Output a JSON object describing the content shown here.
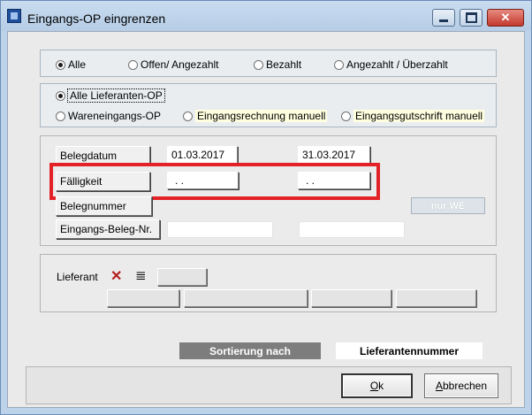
{
  "window": {
    "title": "Eingangs-OP eingrenzen",
    "controls": {
      "close_glyph": "✕"
    }
  },
  "status_filter": {
    "options": [
      {
        "label": "Alle",
        "selected": true
      },
      {
        "label": "Offen/ Angezahlt",
        "selected": false
      },
      {
        "label": "Bezahlt",
        "selected": false
      },
      {
        "label": "Angezahlt / Überzahlt",
        "selected": false
      }
    ]
  },
  "type_filter": {
    "options": [
      {
        "label": "Alle Lieferanten-OP",
        "selected": true
      },
      {
        "label": "Wareneingangs-OP",
        "selected": false
      },
      {
        "label": "Eingangsrechnung manuell",
        "selected": false
      },
      {
        "label": "Eingangsgutschrift manuell",
        "selected": false
      }
    ]
  },
  "ranges": {
    "belegdatum": {
      "label": "Belegdatum",
      "from": "01.03.2017",
      "to": "31.03.2017"
    },
    "faelligkeit": {
      "label": "Fälligkeit",
      "from": ". .",
      "to": ". ."
    },
    "belegnummer": {
      "label": "Belegnummer",
      "nur_we_label": "nur WE"
    },
    "eingangs_beleg_nr": {
      "label": "Eingangs-Beleg-Nr.",
      "from": "",
      "to": ""
    }
  },
  "lieferant": {
    "label": "Lieferant",
    "clear_glyph": "✕",
    "list_glyph": "≣"
  },
  "sort": {
    "label": "Sortierung nach",
    "value": "Lieferantennummer"
  },
  "buttons": {
    "ok_underlined": "O",
    "ok_rest": "k",
    "cancel_underlined": "A",
    "cancel_rest": "bbrechen"
  },
  "colors": {
    "highlight_box": "#e32228",
    "sort_label_bg": "#7d7d7d"
  }
}
